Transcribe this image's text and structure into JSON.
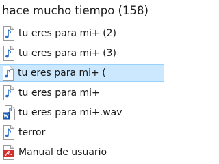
{
  "folder": {
    "title": "hace mucho tiempo (158)"
  },
  "files": [
    {
      "name": "tu eres para mi+ (2)",
      "icon": "audio-file-icon",
      "selected": false
    },
    {
      "name": "tu eres para mi+ (3)",
      "icon": "audio-file-icon",
      "selected": false
    },
    {
      "name": "tu eres para mi+ (",
      "icon": "audio-file-icon",
      "selected": true
    },
    {
      "name": "tu eres para mi+",
      "icon": "audio-file-icon",
      "selected": false
    },
    {
      "name": "tu eres para mi+.wav",
      "icon": "wav-document-icon",
      "selected": false
    },
    {
      "name": "terror",
      "icon": "audio-file-icon",
      "selected": false
    },
    {
      "name": "Manual de usuario",
      "icon": "pdf-file-icon",
      "selected": false
    }
  ],
  "colors": {
    "selection_fill": "#cce8ff",
    "selection_border": "#99d1ff",
    "note_blue": "#2a6fc9",
    "pdf_red": "#d32f2f"
  }
}
